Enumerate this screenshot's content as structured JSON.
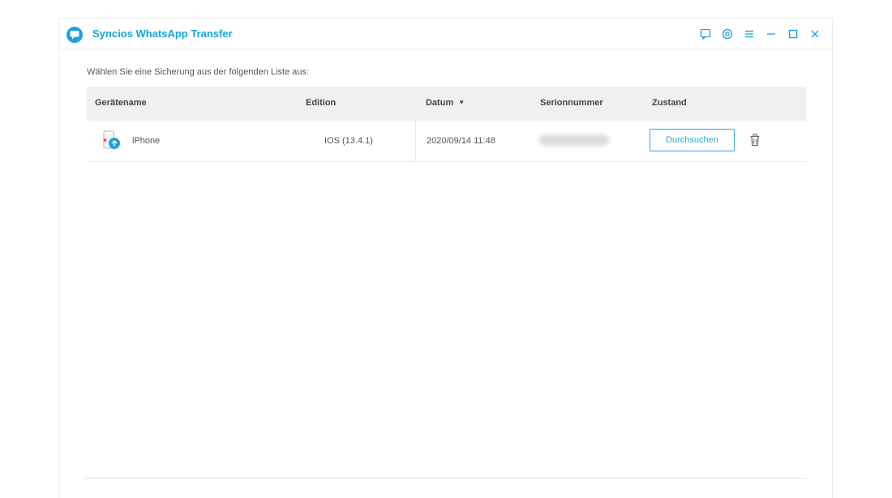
{
  "app": {
    "title": "Syncios WhatsApp Transfer",
    "accent_color": "#1ba3de"
  },
  "window_controls": {
    "icons": [
      "feedback-icon",
      "settings-icon",
      "menu-icon",
      "minimize-icon",
      "maximize-icon",
      "close-icon"
    ]
  },
  "main": {
    "prompt": "Wählen Sie eine Sicherung aus der folgenden Liste aus:"
  },
  "table": {
    "columns": [
      "Gerätename",
      "Edition",
      "Datum",
      "Serionnummer",
      "Zustand"
    ],
    "sorted_column": "Datum",
    "sort_direction": "descending",
    "rows": [
      {
        "device_icon": "iphone-device-icon",
        "device_name": "iPhone",
        "edition": "IOS (13.4.1)",
        "date": "2020/09/14 11:48",
        "serial_visible": "blurred",
        "action_label": "Durchsuchen",
        "delete_icon": "trash-icon"
      }
    ]
  }
}
